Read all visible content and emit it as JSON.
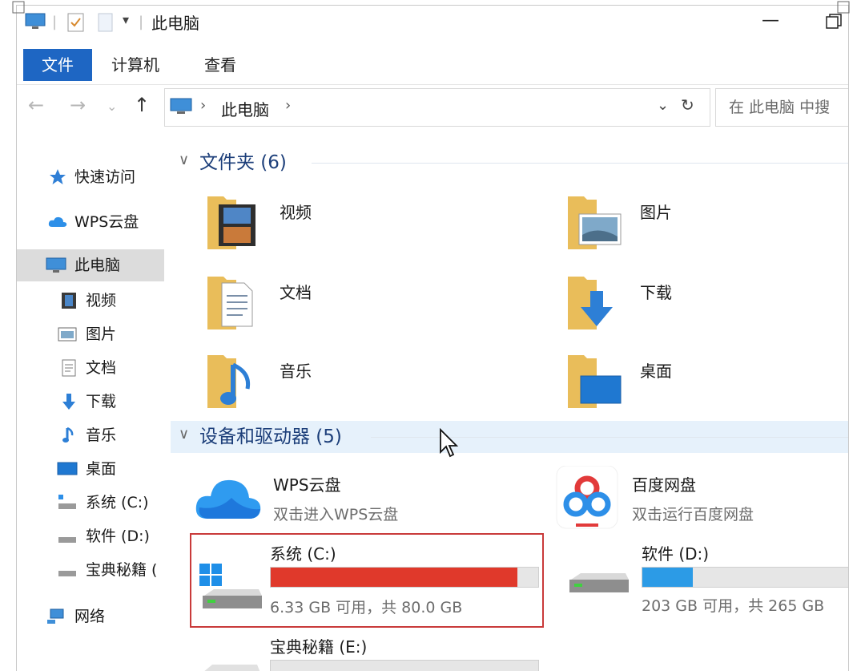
{
  "window": {
    "title": "此电脑",
    "minimize_glyph": "—"
  },
  "ribbon": {
    "tabs": [
      {
        "label": "文件"
      },
      {
        "label": "计算机"
      },
      {
        "label": "查看"
      }
    ]
  },
  "address": {
    "location": "此电脑",
    "search_placeholder": "在 此电脑 中搜"
  },
  "sidebar": {
    "items": [
      {
        "label": "快速访问",
        "icon": "star-icon"
      },
      {
        "label": "WPS云盘",
        "icon": "cloud-icon"
      },
      {
        "label": "此电脑",
        "icon": "computer-icon"
      },
      {
        "label": "视频",
        "icon": "video-icon"
      },
      {
        "label": "图片",
        "icon": "picture-icon"
      },
      {
        "label": "文档",
        "icon": "document-icon"
      },
      {
        "label": "下载",
        "icon": "download-icon"
      },
      {
        "label": "音乐",
        "icon": "music-icon"
      },
      {
        "label": "桌面",
        "icon": "desktop-icon"
      },
      {
        "label": "系统 (C:)",
        "icon": "drive-icon"
      },
      {
        "label": "软件 (D:)",
        "icon": "drive-icon"
      },
      {
        "label": "宝典秘籍 (",
        "icon": "drive-icon"
      },
      {
        "label": "网络",
        "icon": "network-icon"
      }
    ]
  },
  "folders_group": {
    "title": "文件夹 (6)",
    "items": [
      {
        "label": "视频"
      },
      {
        "label": "图片"
      },
      {
        "label": "文档"
      },
      {
        "label": "下载"
      },
      {
        "label": "音乐"
      },
      {
        "label": "桌面"
      }
    ]
  },
  "drives_group": {
    "title": "设备和驱动器 (5)",
    "items": [
      {
        "label": "WPS云盘",
        "sub": "双击进入WPS云盘"
      },
      {
        "label": "百度网盘",
        "sub": "双击运行百度网盘"
      },
      {
        "label": "系统 (C:)",
        "sub": "6.33 GB 可用，共 80.0 GB",
        "used_fraction": 0.921,
        "fill_color": "#e0392b"
      },
      {
        "label": "软件 (D:)",
        "sub": "203 GB 可用，共 265 GB",
        "used_fraction": 0.234,
        "fill_color": "#2c9be6"
      },
      {
        "label": "宝典秘籍 (E:)",
        "sub": ""
      }
    ]
  },
  "colors": {
    "accent": "#1e66c3",
    "highlight_border": "#c93a3a",
    "selection_bg": "#e6f1fb"
  }
}
